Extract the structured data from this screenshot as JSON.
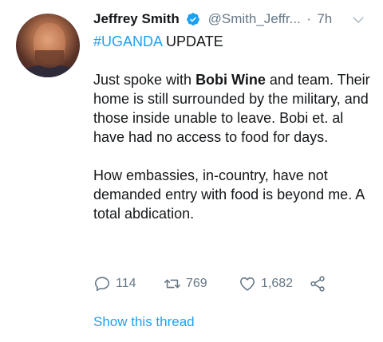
{
  "tweet": {
    "author_name": "Jeffrey Smith",
    "handle": "@Smith_Jeffr...",
    "separator": "·",
    "time": "7h",
    "hashtag": "#UGANDA",
    "tag_suffix": " UPDATE",
    "para1_a": "Just spoke with ",
    "para1_bold": "Bobi Wine",
    "para1_b": " and team. Their home is still surrounded by the military, and those inside unable to leave. Bobi et. al have had no access to food for days.",
    "para2": "How embassies, in-country, have not demanded entry with food is beyond me. A total abdication."
  },
  "actions": {
    "replies": "114",
    "retweets": "769",
    "likes": "1,682"
  },
  "thread_link": "Show this thread",
  "icons": {
    "verified": "verified-badge-icon",
    "menu": "chevron-down-icon",
    "reply": "reply-icon",
    "retweet": "retweet-icon",
    "like": "heart-icon",
    "share": "share-icon"
  },
  "colors": {
    "accent": "#1da1f2",
    "muted": "#657786",
    "text": "#14171a"
  }
}
